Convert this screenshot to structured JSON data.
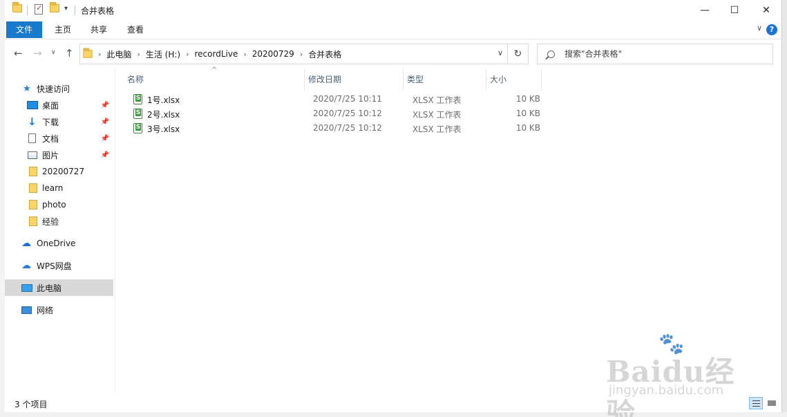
{
  "window": {
    "title": "合并表格",
    "minimize_glyph": "—",
    "maximize_glyph": "☐",
    "close_glyph": "✕"
  },
  "ribbon": {
    "tabs": [
      "文件",
      "主页",
      "共享",
      "查看"
    ],
    "active_tab": "文件",
    "active_color": "#1979ca",
    "help_glyph": "?",
    "expand_glyph": "∨"
  },
  "nav": {
    "back": "←",
    "forward": "→",
    "dropdown": "∨",
    "up": "↑",
    "breadcrumb": [
      "此电脑",
      "生活 (H:)",
      "recordLive",
      "20200729",
      "合并表格"
    ],
    "crumb_sep": "›",
    "address_dropdown": "∨",
    "refresh": "↻",
    "search_placeholder": "搜索\"合并表格\""
  },
  "sidebar": {
    "items": [
      {
        "label": "快速访问",
        "icon": "star-icon"
      },
      {
        "label": "桌面",
        "icon": "desktop-icon",
        "pinned": true
      },
      {
        "label": "下载",
        "icon": "download-icon",
        "pinned": true
      },
      {
        "label": "文档",
        "icon": "document-icon",
        "pinned": true
      },
      {
        "label": "图片",
        "icon": "picture-icon",
        "pinned": true
      },
      {
        "label": "20200727",
        "icon": "folder-icon"
      },
      {
        "label": "learn",
        "icon": "folder-icon"
      },
      {
        "label": "photo",
        "icon": "folder-icon"
      },
      {
        "label": "经验",
        "icon": "folder-icon"
      },
      {
        "label": "OneDrive",
        "icon": "onedrive-icon"
      },
      {
        "label": "WPS网盘",
        "icon": "wps-cloud-icon"
      },
      {
        "label": "此电脑",
        "icon": "computer-icon",
        "selected": true
      },
      {
        "label": "网络",
        "icon": "network-icon"
      }
    ],
    "pin_glyph": "📌"
  },
  "columns": [
    "名称",
    "修改日期",
    "类型",
    "大小"
  ],
  "files": [
    {
      "name": "1号.xlsx",
      "date": "2020/7/25 10:11",
      "type": "XLSX 工作表",
      "size": "10 KB"
    },
    {
      "name": "2号.xlsx",
      "date": "2020/7/25 10:12",
      "type": "XLSX 工作表",
      "size": "10 KB"
    },
    {
      "name": "3号.xlsx",
      "date": "2020/7/25 10:12",
      "type": "XLSX 工作表",
      "size": "10 KB"
    }
  ],
  "status": {
    "count": "3 个项目"
  },
  "watermark": {
    "brand": "Baidu经验",
    "url": "jingyan.baidu.com"
  }
}
